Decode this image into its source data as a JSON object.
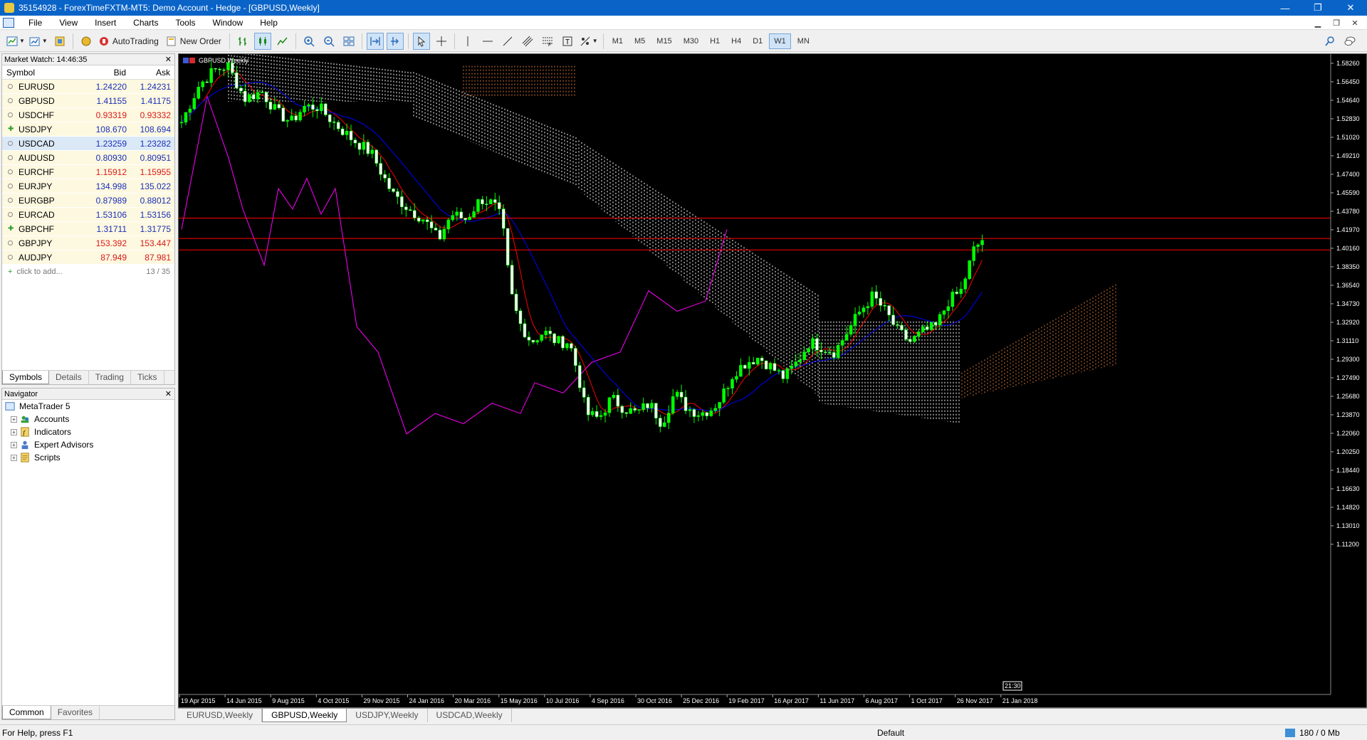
{
  "window": {
    "title": "35154928 - ForexTimeFXTM-MT5: Demo Account - Hedge - [GBPUSD,Weekly]",
    "minimize": "—",
    "restore": "❐",
    "close": "✕"
  },
  "menu": [
    "File",
    "View",
    "Insert",
    "Charts",
    "Tools",
    "Window",
    "Help"
  ],
  "toolbar": {
    "autotrading": "AutoTrading",
    "new_order": "New Order",
    "timeframes": [
      "M1",
      "M5",
      "M15",
      "M30",
      "H1",
      "H4",
      "D1",
      "W1",
      "MN"
    ],
    "active_tf": "W1"
  },
  "market_watch": {
    "title": "Market Watch: 14:46:35",
    "headers": {
      "symbol": "Symbol",
      "bid": "Bid",
      "ask": "Ask"
    },
    "rows": [
      {
        "symbol": "EURUSD",
        "bid": "1.24220",
        "ask": "1.24231",
        "color": "blue",
        "icon": "bullet"
      },
      {
        "symbol": "GBPUSD",
        "bid": "1.41155",
        "ask": "1.41175",
        "color": "blue",
        "icon": "bullet"
      },
      {
        "symbol": "USDCHF",
        "bid": "0.93319",
        "ask": "0.93332",
        "color": "red",
        "icon": "bullet"
      },
      {
        "symbol": "USDJPY",
        "bid": "108.670",
        "ask": "108.694",
        "color": "blue",
        "icon": "arrow"
      },
      {
        "symbol": "USDCAD",
        "bid": "1.23259",
        "ask": "1.23282",
        "color": "blue",
        "icon": "bullet",
        "selected": true
      },
      {
        "symbol": "AUDUSD",
        "bid": "0.80930",
        "ask": "0.80951",
        "color": "blue",
        "icon": "bullet"
      },
      {
        "symbol": "EURCHF",
        "bid": "1.15912",
        "ask": "1.15955",
        "color": "red",
        "icon": "bullet"
      },
      {
        "symbol": "EURJPY",
        "bid": "134.998",
        "ask": "135.022",
        "color": "blue",
        "icon": "bullet"
      },
      {
        "symbol": "EURGBP",
        "bid": "0.87989",
        "ask": "0.88012",
        "color": "blue",
        "icon": "bullet"
      },
      {
        "symbol": "EURCAD",
        "bid": "1.53106",
        "ask": "1.53156",
        "color": "blue",
        "icon": "bullet"
      },
      {
        "symbol": "GBPCHF",
        "bid": "1.31711",
        "ask": "1.31775",
        "color": "blue",
        "icon": "arrow"
      },
      {
        "symbol": "GBPJPY",
        "bid": "153.392",
        "ask": "153.447",
        "color": "red",
        "icon": "bullet"
      },
      {
        "symbol": "AUDJPY",
        "bid": "87.949",
        "ask": "87.981",
        "color": "red",
        "icon": "bullet"
      }
    ],
    "add_label": "click to add...",
    "count": "13 / 35",
    "tabs": [
      "Symbols",
      "Details",
      "Trading",
      "Ticks"
    ]
  },
  "navigator": {
    "title": "Navigator",
    "root": "MetaTrader 5",
    "items": [
      "Accounts",
      "Indicators",
      "Expert Advisors",
      "Scripts"
    ],
    "tabs": [
      "Common",
      "Favorites"
    ]
  },
  "chart": {
    "label": "GBPUSD,Weekly",
    "price_labels": [
      "1.58260",
      "1.56450",
      "1.54640",
      "1.52830",
      "1.51020",
      "1.49210",
      "1.47400",
      "1.45590",
      "1.43780",
      "1.41970",
      "1.40160",
      "1.38350",
      "1.36540",
      "1.34730",
      "1.32920",
      "1.31110",
      "1.29300",
      "1.27490",
      "1.25680",
      "1.23870",
      "1.22060",
      "1.20250",
      "1.18440",
      "1.16630",
      "1.14820",
      "1.13010",
      "1.11200"
    ],
    "hlines": [
      {
        "price": "1.43115",
        "value": 1.43115
      },
      {
        "price": "1.41124",
        "value": 1.41124
      },
      {
        "price": "1.40000",
        "value": 1.4
      }
    ],
    "date_labels": [
      "19 Apr 2015",
      "14 Jun 2015",
      "9 Aug 2015",
      "4 Oct 2015",
      "29 Nov 2015",
      "24 Jan 2016",
      "20 Mar 2016",
      "15 May 2016",
      "10 Jul 2016",
      "4 Sep 2016",
      "30 Oct 2016",
      "25 Dec 2016",
      "19 Feb 2017",
      "16 Apr 2017",
      "11 Jun 2017",
      "6 Aug 2017",
      "1 Oct 2017",
      "26 Nov 2017",
      "21 Jan 2018"
    ],
    "time_marker": "21:30",
    "colors": {
      "bull": "#00ff00",
      "bear": "#ffffff",
      "tenkan": "#ff0000",
      "kijun": "#0000ff",
      "chikou": "#ff00ff",
      "kumo_up": "#ffffff",
      "kumo_down": "#d2783a",
      "hline": "#ff0000"
    }
  },
  "chart_tabs": [
    "EURUSD,Weekly",
    "GBPUSD,Weekly",
    "USDJPY,Weekly",
    "USDCAD,Weekly"
  ],
  "active_chart_tab": "GBPUSD,Weekly",
  "status": {
    "help": "For Help, press F1",
    "profile": "Default",
    "traffic": "180 / 0 Mb"
  }
}
